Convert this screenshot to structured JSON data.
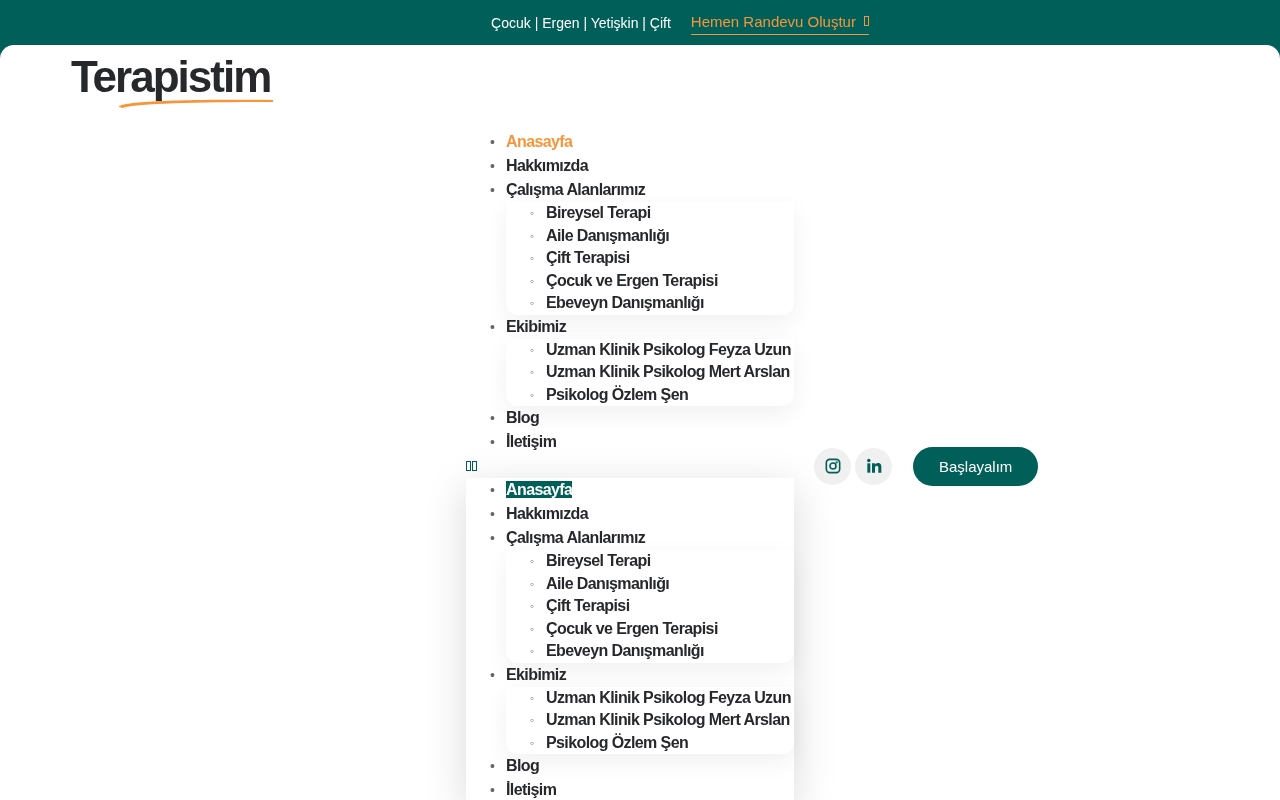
{
  "top_bar": {
    "tagline": "Çocuk | Ergen | Yetişkin | Çift",
    "cta_link": "Hemen Randevu Oluştur"
  },
  "logo": {
    "text": "Terapistim"
  },
  "nav_menu": {
    "bullet": "•",
    "sub_bullet": "◦",
    "items": [
      {
        "label": "Anasayfa",
        "selected": true
      },
      {
        "label": "Hakkımızda",
        "selected": false
      },
      {
        "label": "Çalışma Alanlarımız",
        "selected": false,
        "children": [
          {
            "label": "Bireysel Terapi",
            "selected": false
          },
          {
            "label": "Aile Danışmanlığı",
            "selected": false
          },
          {
            "label": "Çift Terapisi",
            "selected": false
          },
          {
            "label": "Çocuk ve Ergen Terapisi",
            "selected": false
          },
          {
            "label": "Ebeveyn Danışmanlığı",
            "selected": false
          }
        ]
      },
      {
        "label": "Ekibimiz",
        "selected": false,
        "children": [
          {
            "label": "Uzman Klinik Psikolog Feyza Uzun",
            "selected": false
          },
          {
            "label": "Uzman Klinik Psikolog Mert Arslan",
            "selected": false
          },
          {
            "label": "Psikolog Özlem Şen",
            "selected": false
          }
        ]
      },
      {
        "label": "Blog",
        "selected": false
      },
      {
        "label": "İletişim",
        "selected": false
      }
    ]
  },
  "cta_button": "Başlayalım",
  "mobile_menu": {
    "expanded": true,
    "bullet": "•",
    "sub_bullet": "◦",
    "items": [
      {
        "label": "Anasayfa",
        "selected": true
      },
      {
        "label": "Hakkımızda",
        "selected": false
      },
      {
        "label": "Çalışma Alanlarımız",
        "selected": false,
        "children": [
          {
            "label": "Bireysel Terapi",
            "selected": false
          },
          {
            "label": "Aile Danışmanlığı",
            "selected": false
          },
          {
            "label": "Çift Terapisi",
            "selected": false
          },
          {
            "label": "Çocuk ve Ergen Terapisi",
            "selected": false
          },
          {
            "label": "Ebeveyn Danışmanlığı",
            "selected": false
          }
        ]
      },
      {
        "label": "Ekibimiz",
        "selected": false,
        "children": [
          {
            "label": "Uzman Klinik Psikolog Feyza Uzun",
            "selected": false
          },
          {
            "label": "Uzman Klinik Psikolog Mert Arslan",
            "selected": false
          },
          {
            "label": "Psikolog Özlem Şen",
            "selected": false
          }
        ]
      },
      {
        "label": "Blog",
        "selected": false
      },
      {
        "label": "İletişim",
        "selected": false
      }
    ]
  }
}
